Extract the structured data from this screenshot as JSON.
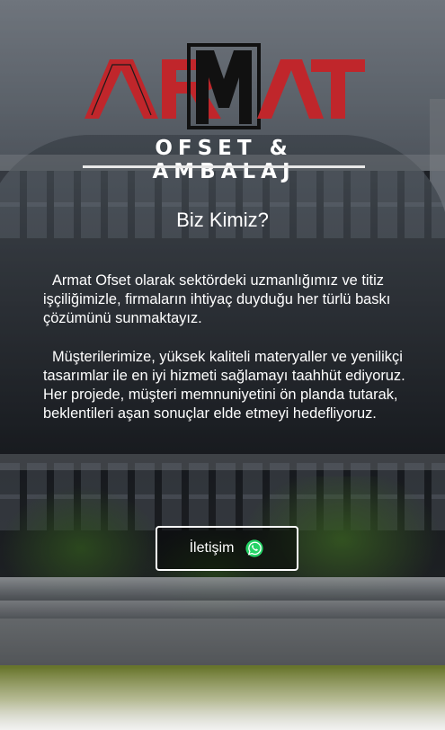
{
  "brand": {
    "logo_text": "ARMAT",
    "subtitle": "OFSET & AMBALAJ",
    "colors": {
      "red": "#c0262b",
      "black": "#111111"
    }
  },
  "about": {
    "title": "Biz Kimiz?",
    "paragraph_1": "Armat Ofset olarak sektördeki uzmanlığımız ve titiz işçiliğimizle, firmaların ihtiyaç duyduğu her türlü baskı çözümünü sunmaktayız.",
    "paragraph_2": "Müşterilerimize, yüksek kaliteli materyaller ve yenilikçi tasarımlar ile en iyi hizmeti sağlamayı taahhüt ediyoruz. Her projede, müşteri memnuniyetini ön planda tutarak, beklentileri aşan sonuçlar elde etmeyi hedefliyoruz."
  },
  "contact_button": {
    "label": "İletişim",
    "icon": "whatsapp-icon",
    "icon_color": "#25d366"
  }
}
